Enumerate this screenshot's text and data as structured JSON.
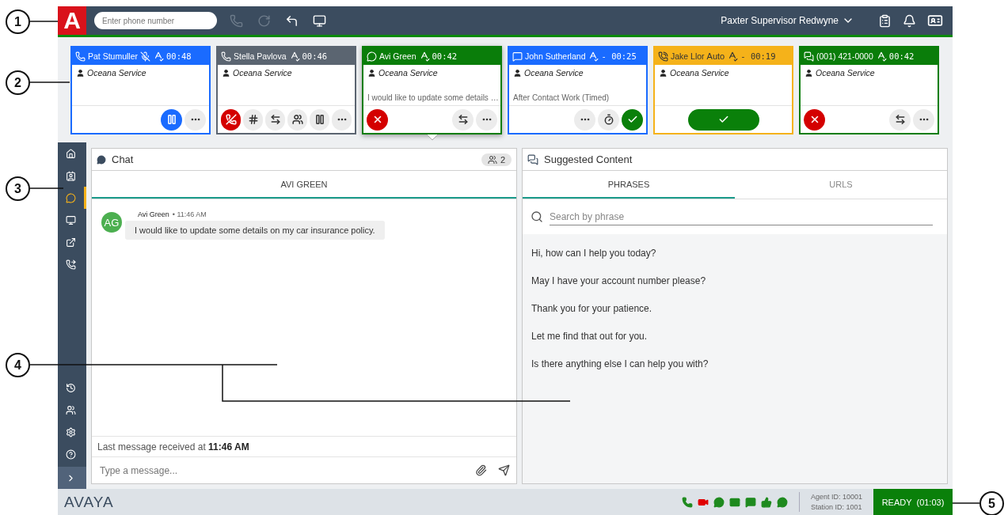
{
  "callouts": [
    {
      "number": "1"
    },
    {
      "number": "2"
    },
    {
      "number": "3"
    },
    {
      "number": "4"
    },
    {
      "number": "5"
    }
  ],
  "top_bar": {
    "logo": "A",
    "phone_placeholder": "Enter phone number",
    "tools": [
      {
        "kind": "call",
        "disabled": true
      },
      {
        "kind": "redo",
        "disabled": true
      },
      {
        "kind": "reply",
        "disabled": false
      },
      {
        "kind": "screen",
        "disabled": false
      }
    ],
    "user": "Paxter Supervisor Redwyne"
  },
  "interactions": [
    {
      "name": "Pat Stumuller",
      "kind": "voice",
      "color": "#1a6bff",
      "muted": true,
      "timer": "00:48",
      "selected": false,
      "service": "Oceana Service",
      "actions": [
        {
          "kind": "pause-active"
        },
        {
          "kind": "more"
        }
      ]
    },
    {
      "name": "Stella Pavlova",
      "kind": "voice",
      "color": "#5b6571",
      "muted": false,
      "timer": "00:46",
      "selected": false,
      "service": "Oceana Service",
      "actions": [
        {
          "kind": "hangup"
        },
        {
          "kind": "dialpad"
        },
        {
          "kind": "transfer"
        },
        {
          "kind": "conference"
        },
        {
          "kind": "pause"
        },
        {
          "kind": "more"
        }
      ]
    },
    {
      "name": "Avi Green",
      "kind": "chat",
      "color": "#0a7d0a",
      "muted": false,
      "timer": "00:42",
      "selected": true,
      "service": "Oceana Service",
      "detail": "I would like to update some details …",
      "actions": [
        {
          "kind": "reject"
        },
        {
          "kind": "transfer"
        },
        {
          "kind": "more"
        }
      ]
    },
    {
      "name": "John Sutherland",
      "kind": "sms",
      "color": "#1a6bff",
      "muted": false,
      "timer": "- 00:25",
      "selected": false,
      "service": "Oceana Service",
      "detail": "After Contact Work (Timed)",
      "actions": [
        {
          "kind": "more"
        },
        {
          "kind": "timer"
        },
        {
          "kind": "accept"
        }
      ]
    },
    {
      "name": "Jake Llor",
      "kind": "callback",
      "color": "#f5b21a",
      "muted": false,
      "mode": "Auto",
      "timer": "- 00:19",
      "selected": false,
      "service": "Oceana Service",
      "actions": [
        {
          "kind": "accept-wide"
        }
      ]
    },
    {
      "name": "(001) 421-0000",
      "kind": "messages",
      "color": "#0a7d0a",
      "muted": false,
      "timer": "00:42",
      "selected": false,
      "service": "Oceana Service",
      "actions": [
        {
          "kind": "reject"
        },
        {
          "kind": "transfer"
        },
        {
          "kind": "more"
        }
      ]
    }
  ],
  "sidebar": {
    "items": [
      {
        "kind": "home",
        "selected": false
      },
      {
        "kind": "contacts",
        "selected": false
      },
      {
        "kind": "chat",
        "selected": true
      },
      {
        "kind": "screen",
        "selected": false
      },
      {
        "kind": "external",
        "selected": false
      },
      {
        "kind": "phone-settings",
        "selected": false
      }
    ],
    "footer_items": [
      {
        "kind": "history",
        "selected": false
      },
      {
        "kind": "team",
        "selected": false
      },
      {
        "kind": "settings",
        "selected": false
      },
      {
        "kind": "help",
        "selected": false
      },
      {
        "kind": "expand",
        "selected": false
      }
    ]
  },
  "chat": {
    "title": "Chat",
    "participants": "2",
    "tabs": [
      {
        "label": "AVI GREEN",
        "selected": true
      }
    ],
    "messages": [
      {
        "initials": "AG",
        "sender": "Avi Green",
        "time": "• 11:46 AM",
        "text": "I would like to update some details on my car insurance policy."
      }
    ],
    "status": "Last message received at **11:46 AM**",
    "input_placeholder": "Type a message..."
  },
  "suggested": {
    "title": "Suggested Content",
    "tabs": [
      {
        "label": "PHRASES",
        "selected": true
      },
      {
        "label": "URLS",
        "selected": false
      }
    ],
    "search_placeholder": "Search by phrase",
    "phrases": [
      "Hi, how can I help you today?",
      "May I have your account number please?",
      "Thank you for your patience.",
      "Let me find that out for you.",
      "Is there anything else I can help you with?"
    ]
  },
  "status_bar": {
    "brand": "AVAYA",
    "channels": [
      {
        "kind": "phone",
        "color": "#1e8a1e"
      },
      {
        "kind": "video",
        "color": "#e00000"
      },
      {
        "kind": "chat",
        "color": "#1e8a1e"
      },
      {
        "kind": "email",
        "color": "#1e8a1e"
      },
      {
        "kind": "sms",
        "color": "#1e8a1e"
      },
      {
        "kind": "social",
        "color": "#1e8a1e"
      },
      {
        "kind": "messenger",
        "color": "#1e8a1e"
      }
    ],
    "agent_id": "Agent ID: 10001",
    "station_id": "Station ID: 1001",
    "state": "READY  (01:03)"
  }
}
